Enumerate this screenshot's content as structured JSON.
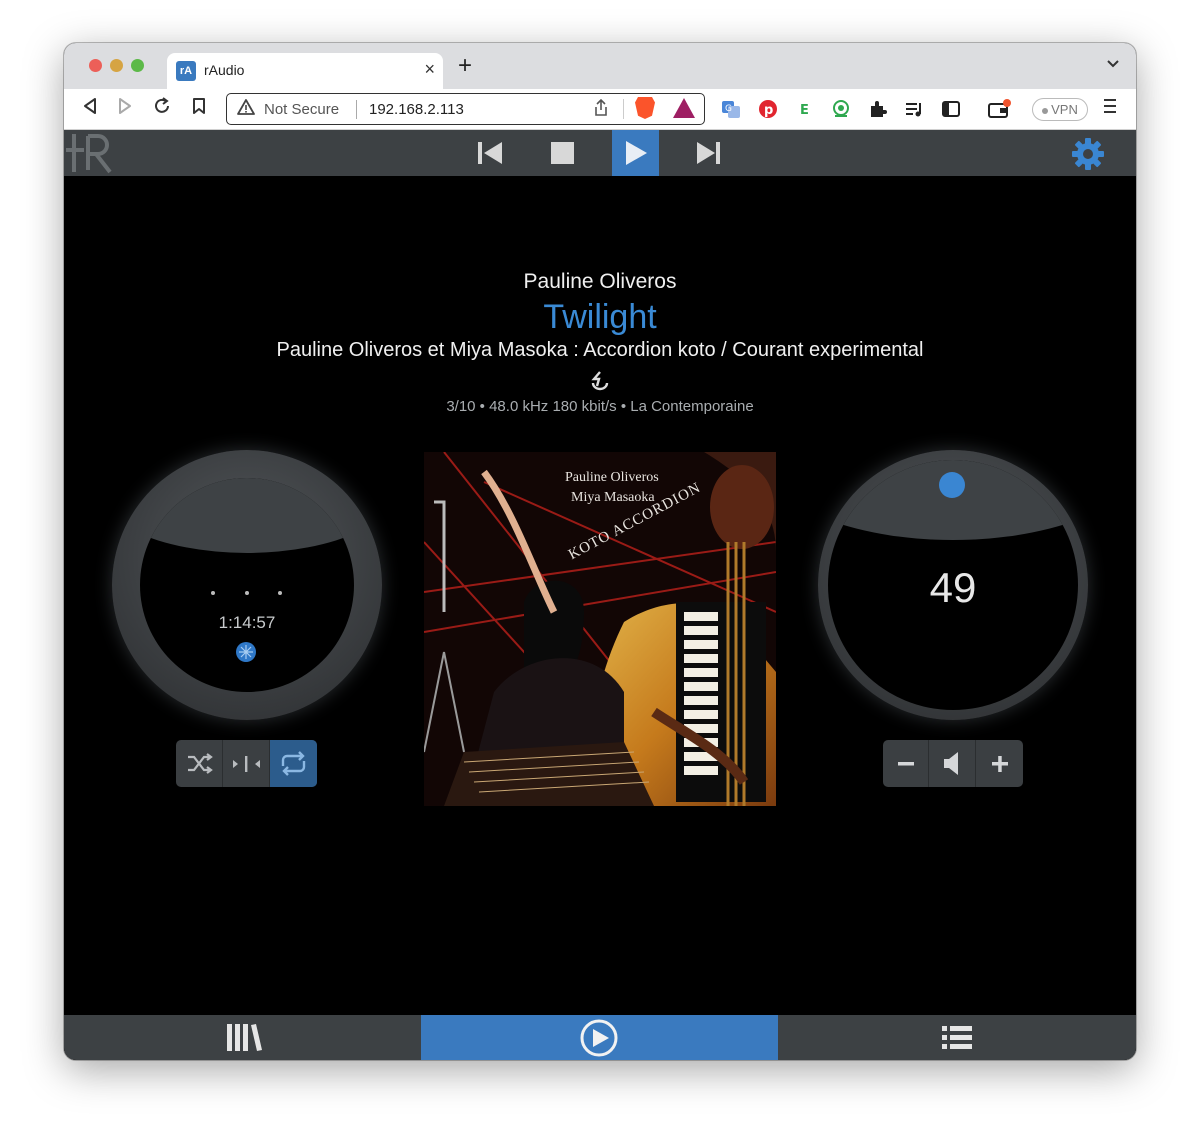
{
  "browser": {
    "tab_title": "rAudio",
    "tab_favicon": "rA",
    "tab_close": "×",
    "new_tab": "+",
    "tab_menu": "⌄",
    "security_label": "Not Secure",
    "url": "192.168.2.113",
    "vpn_label": "VPN"
  },
  "player": {
    "artist": "Pauline Oliveros",
    "title": "Twilight",
    "album": "Pauline Oliveros et Miya Masoka : Accordion koto / Courant experimental",
    "info": "3/10 • 48.0 kHz 180 kbit/s • La Contemporaine",
    "elapsed": "1:14:57",
    "volume": "49",
    "active_control": "play",
    "active_nav": "playback",
    "modes": {
      "random": false,
      "single": false,
      "repeat": true
    }
  },
  "cover": {
    "line1": "Pauline Oliveros",
    "line2": "Miya Masaoka",
    "line3": "KOTO ACCORDION"
  },
  "colors": {
    "accent": "#3a7abf",
    "title": "#3a8ad5",
    "bar": "#3d4144"
  },
  "icons": {
    "back": "◁",
    "forward": "▷",
    "reload": "C",
    "bookmark": "🔖",
    "warning": "⚠",
    "share": "⇧",
    "settings": "gear-icon",
    "elapsed": "spinner-icon"
  }
}
